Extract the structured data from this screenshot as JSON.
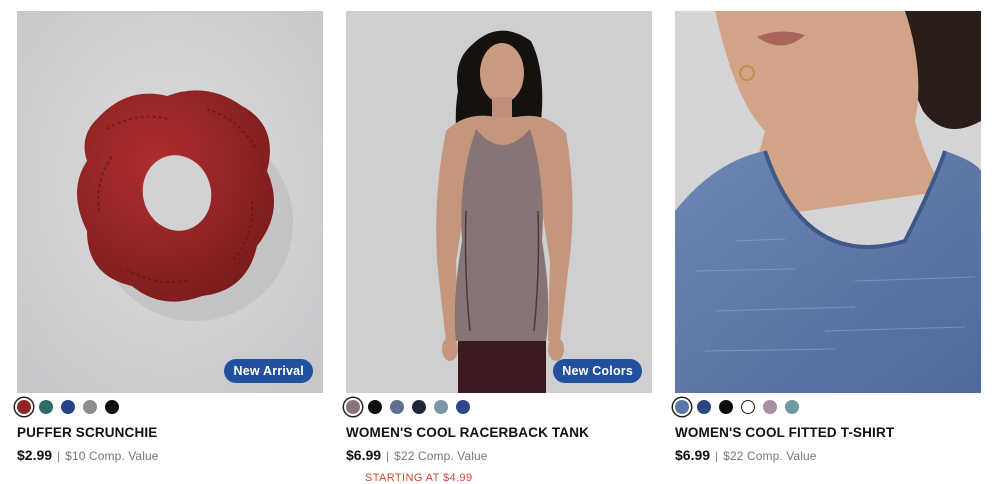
{
  "products": [
    {
      "name": "PUFFER SCRUNCHIE",
      "badge": "New Arrival",
      "image_alt": "Red puffer scrunchie",
      "swatches": [
        "#8e2424",
        "#2d6a68",
        "#24448a",
        "#8d8d8f",
        "#0d0d0d"
      ],
      "selected_swatch": 0,
      "price": "$2.99",
      "separator": "|",
      "comp_value": "$10 Comp. Value"
    },
    {
      "name": "WOMEN'S COOL RACERBACK TANK",
      "badge": "New Colors",
      "image_alt": "Woman in heather mauve racerback tank",
      "swatches": [
        "#8a7476",
        "#0e0e0e",
        "#5e6f94",
        "#1f2634",
        "#7b96a6",
        "#2d4788"
      ],
      "selected_swatch": 0,
      "price": "$6.99",
      "separator": "|",
      "comp_value": "$22 Comp. Value",
      "promo": "STARTING AT $4.99"
    },
    {
      "name": "WOMEN'S COOL FITTED T-SHIRT",
      "image_alt": "Woman in heather blue fitted t-shirt",
      "swatches": [
        "#5a77a8",
        "#2c4683",
        "#0c0c0c",
        "#ffffff",
        "#a88ea3",
        "#6e9aa6"
      ],
      "selected_swatch": 0,
      "price": "$6.99",
      "separator": "|",
      "comp_value": "$22 Comp. Value"
    }
  ]
}
